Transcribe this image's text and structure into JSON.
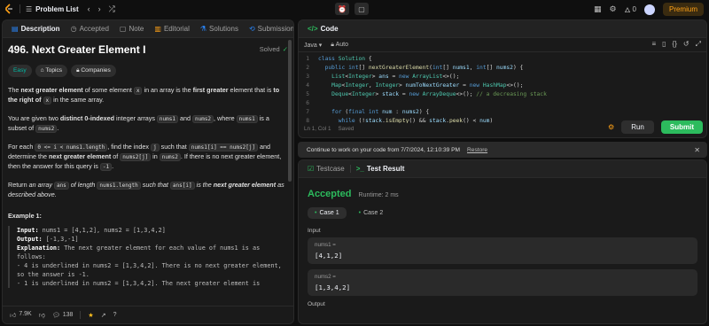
{
  "topnav": {
    "problem_list": "Problem List",
    "streak": "0",
    "premium": "Premium"
  },
  "left": {
    "tabs": [
      "Description",
      "Accepted",
      "Note",
      "Editorial",
      "Solutions",
      "Submissions"
    ],
    "title": "496. Next Greater Element I",
    "solved": "Solved",
    "chips": [
      "Easy",
      "Topics",
      "Companies"
    ],
    "p1": {
      "t1": "The ",
      "b1": "next greater element",
      "t2": " of some element ",
      "c1": "x",
      "t3": " in an array is the ",
      "b2": "first greater",
      "t4": " element that is ",
      "b3": "to the right of",
      "c2": "x",
      "t5": " in the same array."
    },
    "p2": {
      "t1": "You are given two ",
      "b1": "distinct 0-indexed",
      "t2": " integer arrays ",
      "c1": "nums1",
      "t3": " and ",
      "c2": "nums2",
      "t4": ", where ",
      "c3": "nums1",
      "t5": " is a subset of ",
      "c4": "nums2",
      "t6": "."
    },
    "p3": {
      "t1": "For each ",
      "c1": "0 <= i < nums1.length",
      "t2": ", find the index ",
      "c2": "j",
      "t3": " such that ",
      "c3": "nums1[i] == nums2[j]",
      "t4": " and determine the ",
      "b1": "next greater element",
      "t5": " of ",
      "c4": "nums2[j]",
      "t6": " in ",
      "c5": "nums2",
      "t7": ". If there is no next greater element, then the answer for this query is ",
      "c6": "-1",
      "t8": "."
    },
    "p4": {
      "t1": "Return ",
      "i1": "an array ",
      "c1": "ans",
      "i2": " of length ",
      "c2": "nums1.length",
      "i3": " such that ",
      "c3": "ans[i]",
      "i4": " is the ",
      "b1": "next greater element",
      "i5": " as described above."
    },
    "example_title": "Example 1:",
    "example": {
      "input_label": "Input:",
      "input": " nums1 = [4,1,2], nums2 = [1,3,4,2]",
      "output_label": "Output:",
      "output": " [-1,3,-1]",
      "explanation_label": "Explanation:",
      "explanation": " The next greater element for each value of nums1 is as follows:",
      "line1": "- 4 is underlined in nums2 = [1,3,4,2]. There is no next greater element, so the answer is -1.",
      "line2": "- 1 is underlined in nums2 = [1,3,4,2]. The next greater element is"
    },
    "footer": {
      "likes": "7.9K",
      "comments": "138"
    }
  },
  "code": {
    "tab": "Code",
    "language": "Java",
    "mode": "Auto",
    "lines": [
      {
        "n": "1",
        "html": "<span class='kw'>class</span> <span class='ty'>Solution</span> <span class='pl'>{</span>"
      },
      {
        "n": "2",
        "html": "  <span class='kw'>public</span> <span class='kw'>int</span><span class='pl'>[] </span><span class='fn'>nextGreaterElement</span><span class='pl'>(</span><span class='kw'>int</span><span class='pl'>[] </span><span class='vr'>nums1</span><span class='pl'>, </span><span class='kw'>int</span><span class='pl'>[] </span><span class='vr'>nums2</span><span class='pl'>) {</span>"
      },
      {
        "n": "3",
        "html": "    <span class='ty'>List</span><span class='pl'>&lt;</span><span class='ty'>Integer</span><span class='pl'>&gt; </span><span class='vr'>ans</span> <span class='pl'>=</span> <span class='kw'>new</span> <span class='ty'>ArrayList</span><span class='pl'>&lt;&gt;();</span>"
      },
      {
        "n": "4",
        "html": "    <span class='ty'>Map</span><span class='pl'>&lt;</span><span class='ty'>Integer</span><span class='pl'>, </span><span class='ty'>Integer</span><span class='pl'>&gt; </span><span class='vr'>numToNextGreater</span> <span class='pl'>=</span> <span class='kw'>new</span> <span class='ty'>HashMap</span><span class='pl'>&lt;&gt;();</span>"
      },
      {
        "n": "5",
        "html": "    <span class='ty'>Deque</span><span class='pl'>&lt;</span><span class='ty'>Integer</span><span class='pl'>&gt; </span><span class='vr'>stack</span> <span class='pl'>=</span> <span class='kw'>new</span> <span class='ty'>ArrayDeque</span><span class='pl'>&lt;&gt;(); </span><span class='cm'>// a decreasing stack</span>"
      },
      {
        "n": "6",
        "html": ""
      },
      {
        "n": "7",
        "html": "    <span class='kw'>for</span> <span class='pl'>(</span><span class='kw'>final</span> <span class='kw'>int</span> <span class='vr'>num</span> <span class='pl'>: </span><span class='vr'>nums2</span><span class='pl'>) {</span>"
      },
      {
        "n": "8",
        "html": "      <span class='kw'>while</span> <span class='pl'>(!</span><span class='vr'>stack</span><span class='pl'>.</span><span class='fn'>isEmpty</span><span class='pl'>() &amp;&amp; </span><span class='vr'>stack</span><span class='pl'>.</span><span class='fn'>peek</span><span class='pl'>() &lt; </span><span class='vr'>num</span><span class='pl'>)</span>"
      }
    ],
    "cursor": "Ln 1, Col 1",
    "saved": "Saved",
    "run": "Run",
    "submit": "Submit"
  },
  "notice": {
    "text": "Continue to work on your code from 7/7/2024, 12:10:39 PM",
    "restore": "Restore"
  },
  "result": {
    "tabs": [
      "Testcase",
      "Test Result"
    ],
    "status": "Accepted",
    "runtime": "Runtime: 2 ms",
    "cases": [
      "Case 1",
      "Case 2"
    ],
    "input_label": "Input",
    "inputs": [
      {
        "k": "nums1 =",
        "v": "[4,1,2]"
      },
      {
        "k": "nums2 =",
        "v": "[1,3,4,2]"
      }
    ],
    "output_label": "Output"
  },
  "colors": {
    "accent_green": "#2cbb5d",
    "premium": "#ffa116",
    "easy": "#00b8a3"
  }
}
